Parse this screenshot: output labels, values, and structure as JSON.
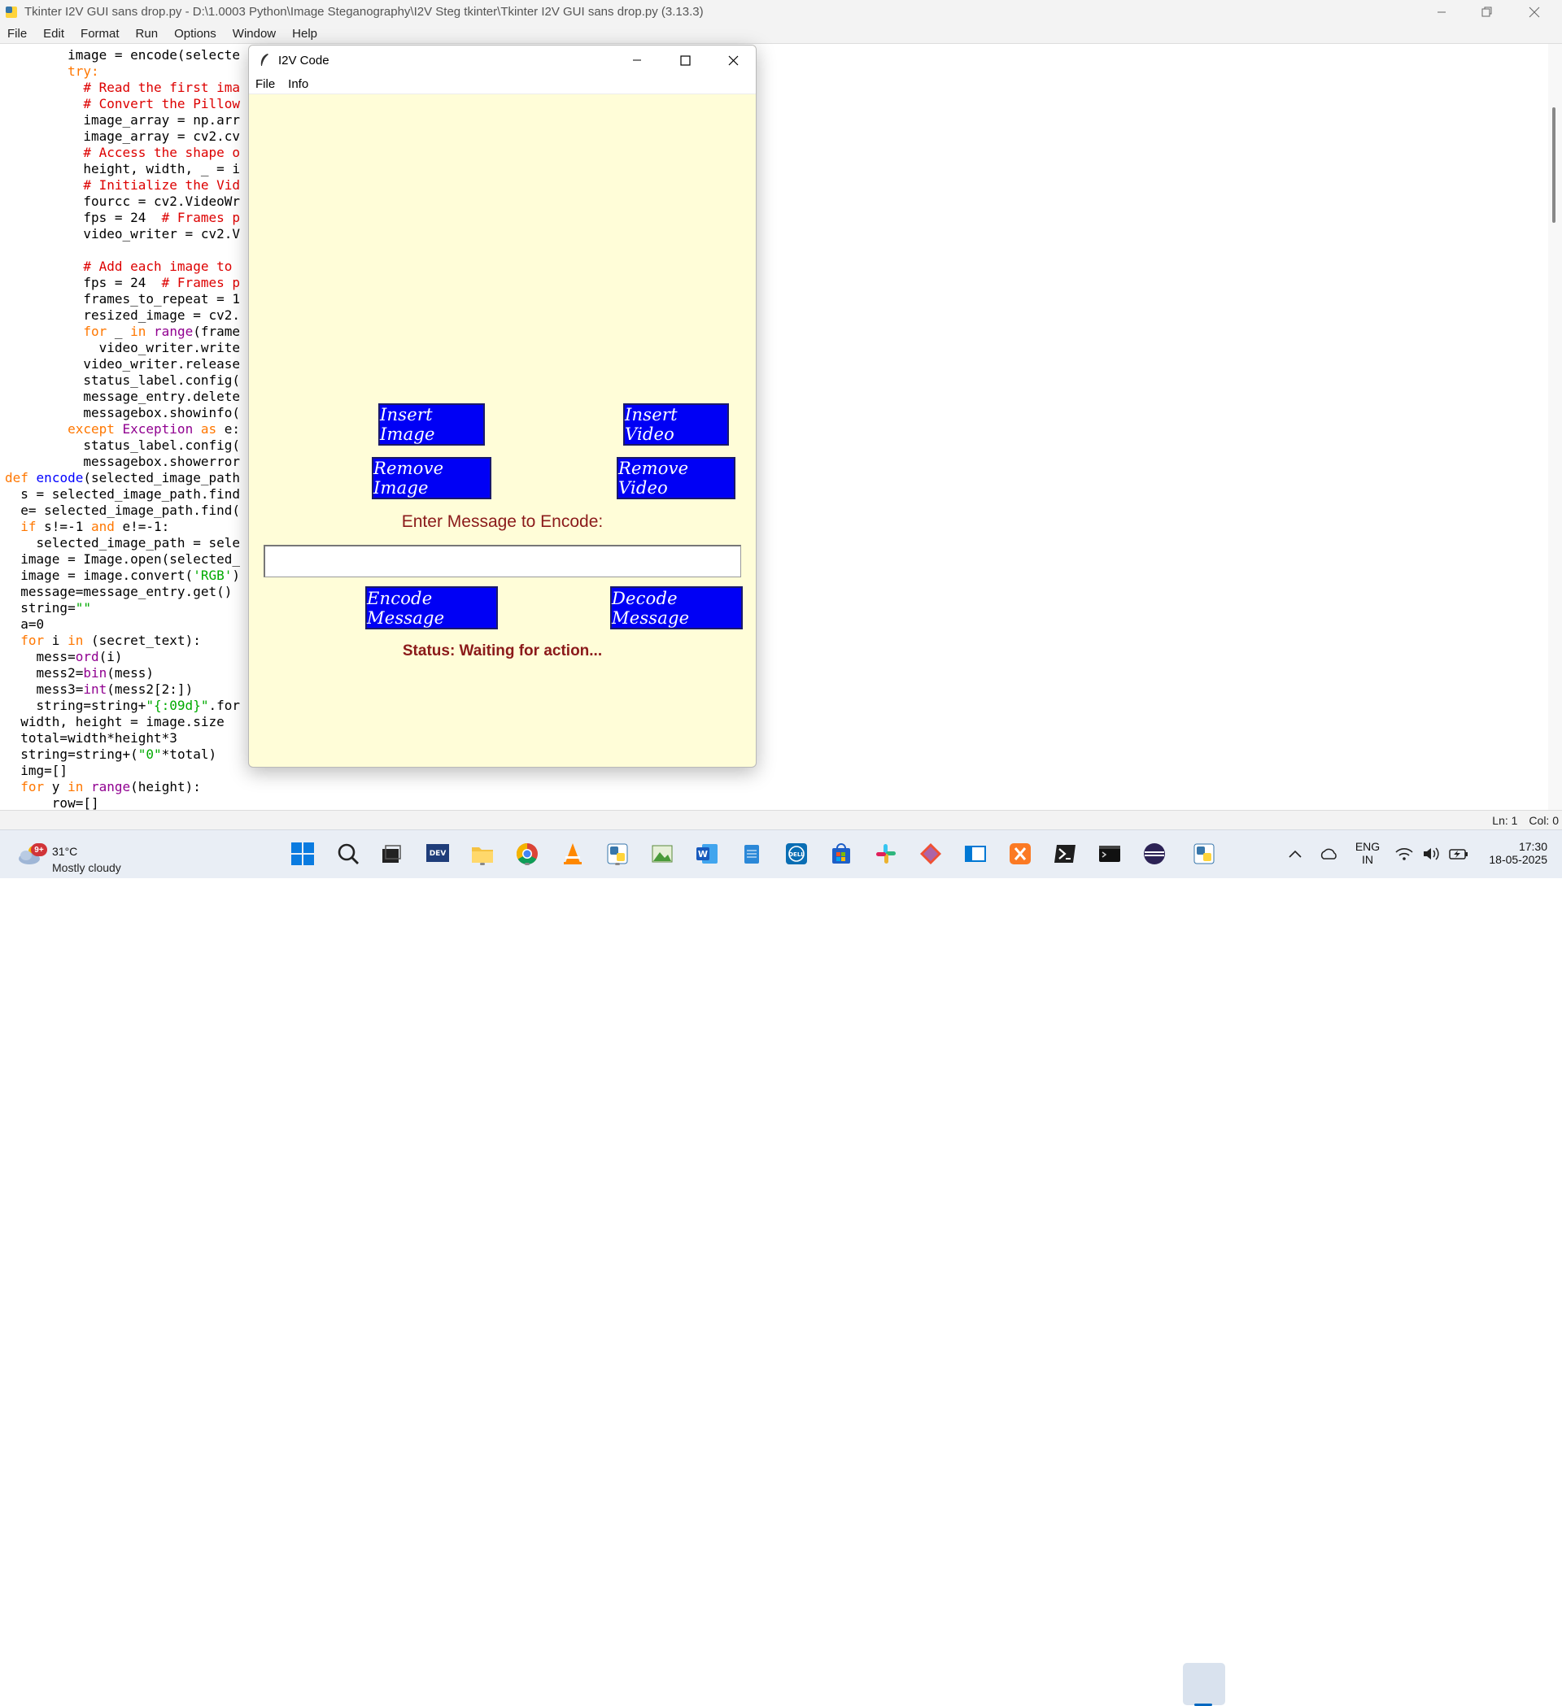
{
  "idle": {
    "title": "Tkinter I2V GUI sans drop.py - D:\\1.0003 Python\\Image Steganography\\I2V Steg tkinter\\Tkinter I2V GUI sans drop.py (3.13.3)",
    "menu": [
      "File",
      "Edit",
      "Format",
      "Run",
      "Options",
      "Window",
      "Help"
    ],
    "status": {
      "line": "Ln: 1",
      "col": "Col: 0"
    }
  },
  "code_lines": [
    [
      [
        "",
        "        image = encode(selecte"
      ]
    ],
    [
      [
        "kw",
        "        try:"
      ]
    ],
    [
      [
        "cm",
        "          # Read the first ima"
      ]
    ],
    [
      [
        "cm",
        "          # Convert the Pillow"
      ]
    ],
    [
      [
        "",
        "          image_array = np.arr"
      ]
    ],
    [
      [
        "",
        "          image_array = cv2.cv"
      ]
    ],
    [
      [
        "cm",
        "          # Access the shape o"
      ]
    ],
    [
      [
        "",
        "          height, width, _ = i"
      ]
    ],
    [
      [
        "cm",
        "          # Initialize the Vid"
      ]
    ],
    [
      [
        "",
        "          fourcc = cv2.VideoWr"
      ]
    ],
    [
      [
        "",
        "          fps = 24  "
      ],
      [
        "cm",
        "# Frames p"
      ]
    ],
    [
      [
        "",
        "          video_writer = cv2.V"
      ]
    ],
    [
      [
        "",
        ""
      ]
    ],
    [
      [
        "cm",
        "          # Add each image to "
      ]
    ],
    [
      [
        "",
        "          fps = 24  "
      ],
      [
        "cm",
        "# Frames p"
      ]
    ],
    [
      [
        "",
        "          frames_to_repeat = 1"
      ]
    ],
    [
      [
        "",
        "          resized_image = cv2."
      ]
    ],
    [
      [
        "kw",
        "          for"
      ],
      [
        "",
        " _ "
      ],
      [
        "kw",
        "in"
      ],
      [
        "",
        " "
      ],
      [
        "bi",
        "range"
      ],
      [
        "",
        "(frame"
      ]
    ],
    [
      [
        "",
        "            video_writer.write"
      ]
    ],
    [
      [
        "",
        "          video_writer.release"
      ]
    ],
    [
      [
        "",
        "          status_label.config("
      ]
    ],
    [
      [
        "",
        "          message_entry.delete"
      ]
    ],
    [
      [
        "",
        "          messagebox.showinfo("
      ]
    ],
    [
      [
        "kw",
        "        except"
      ],
      [
        "",
        " "
      ],
      [
        "bi",
        "Exception"
      ],
      [
        "",
        " "
      ],
      [
        "kw",
        "as"
      ],
      [
        "",
        " e:"
      ]
    ],
    [
      [
        "",
        "          status_label.config("
      ]
    ],
    [
      [
        "",
        "          messagebox.showerror"
      ]
    ],
    [
      [
        "kw",
        "def"
      ],
      [
        "",
        " "
      ],
      [
        "fn",
        "encode"
      ],
      [
        "",
        "(selected_image_path"
      ]
    ],
    [
      [
        "",
        "  s = selected_image_path.find"
      ]
    ],
    [
      [
        "",
        "  e= selected_image_path.find("
      ]
    ],
    [
      [
        "kw",
        "  if"
      ],
      [
        "",
        " s!=-1 "
      ],
      [
        "kw",
        "and"
      ],
      [
        "",
        " e!=-1:"
      ]
    ],
    [
      [
        "",
        "    selected_image_path = sele"
      ]
    ],
    [
      [
        "",
        "  image = Image.open(selected_"
      ]
    ],
    [
      [
        "",
        "  image = image.convert("
      ],
      [
        "st",
        "'RGB'"
      ],
      [
        "",
        ")"
      ]
    ],
    [
      [
        "",
        "  message=message_entry.get()"
      ]
    ],
    [
      [
        "",
        "  string="
      ],
      [
        "st",
        "\"\""
      ]
    ],
    [
      [
        "",
        "  a=0"
      ]
    ],
    [
      [
        "kw",
        "  for"
      ],
      [
        "",
        " i "
      ],
      [
        "kw",
        "in"
      ],
      [
        "",
        " (secret_text):"
      ]
    ],
    [
      [
        "",
        "    mess="
      ],
      [
        "bi",
        "ord"
      ],
      [
        "",
        "(i)"
      ]
    ],
    [
      [
        "",
        "    mess2="
      ],
      [
        "bi",
        "bin"
      ],
      [
        "",
        "(mess)"
      ]
    ],
    [
      [
        "",
        "    mess3="
      ],
      [
        "bi",
        "int"
      ],
      [
        "",
        "(mess2[2:])"
      ]
    ],
    [
      [
        "",
        "    string=string+"
      ],
      [
        "st",
        "\"{:09d}\""
      ],
      [
        "",
        ".for"
      ]
    ],
    [
      [
        "",
        "  width, height = image.size"
      ]
    ],
    [
      [
        "",
        "  total=width*height*3"
      ]
    ],
    [
      [
        "",
        "  string=string+("
      ],
      [
        "st",
        "\"0\""
      ],
      [
        "",
        "*total)"
      ]
    ],
    [
      [
        "",
        "  img=[]"
      ]
    ],
    [
      [
        "kw",
        "  for"
      ],
      [
        "",
        " y "
      ],
      [
        "kw",
        "in"
      ],
      [
        "",
        " "
      ],
      [
        "bi",
        "range"
      ],
      [
        "",
        "(height):"
      ]
    ],
    [
      [
        "",
        "      row=[]"
      ]
    ]
  ],
  "tk": {
    "title": "I2V Code",
    "menu": [
      "File",
      "Info"
    ],
    "buttons": {
      "insert_image": "Insert Image",
      "insert_video": "Insert Video",
      "remove_image": "Remove Image",
      "remove_video": "Remove Video",
      "encode": "Encode Message",
      "decode": "Decode Message"
    },
    "enter_label": "Enter Message to Encode:",
    "entry_value": "",
    "status": "Status: Waiting for action..."
  },
  "taskbar": {
    "weather": {
      "badge": "9+",
      "temp": "31°C",
      "condition": "Mostly cloudy"
    },
    "apps": [
      "start",
      "search",
      "task-view",
      "dev",
      "file-explorer",
      "chrome",
      "vlc",
      "python-idle",
      "photos",
      "word",
      "notepad",
      "dell",
      "store",
      "slack",
      "git",
      "remote-desktop",
      "xampp",
      "powershell",
      "terminal",
      "eclipse",
      "python-tk"
    ],
    "lang": {
      "line1": "ENG",
      "line2": "IN"
    },
    "time": "17:30",
    "date": "18-05-2025"
  },
  "colors": {
    "tk_background": "#fffdd8",
    "button_blue": "#0000f5",
    "label_red": "#8b1a1a"
  }
}
